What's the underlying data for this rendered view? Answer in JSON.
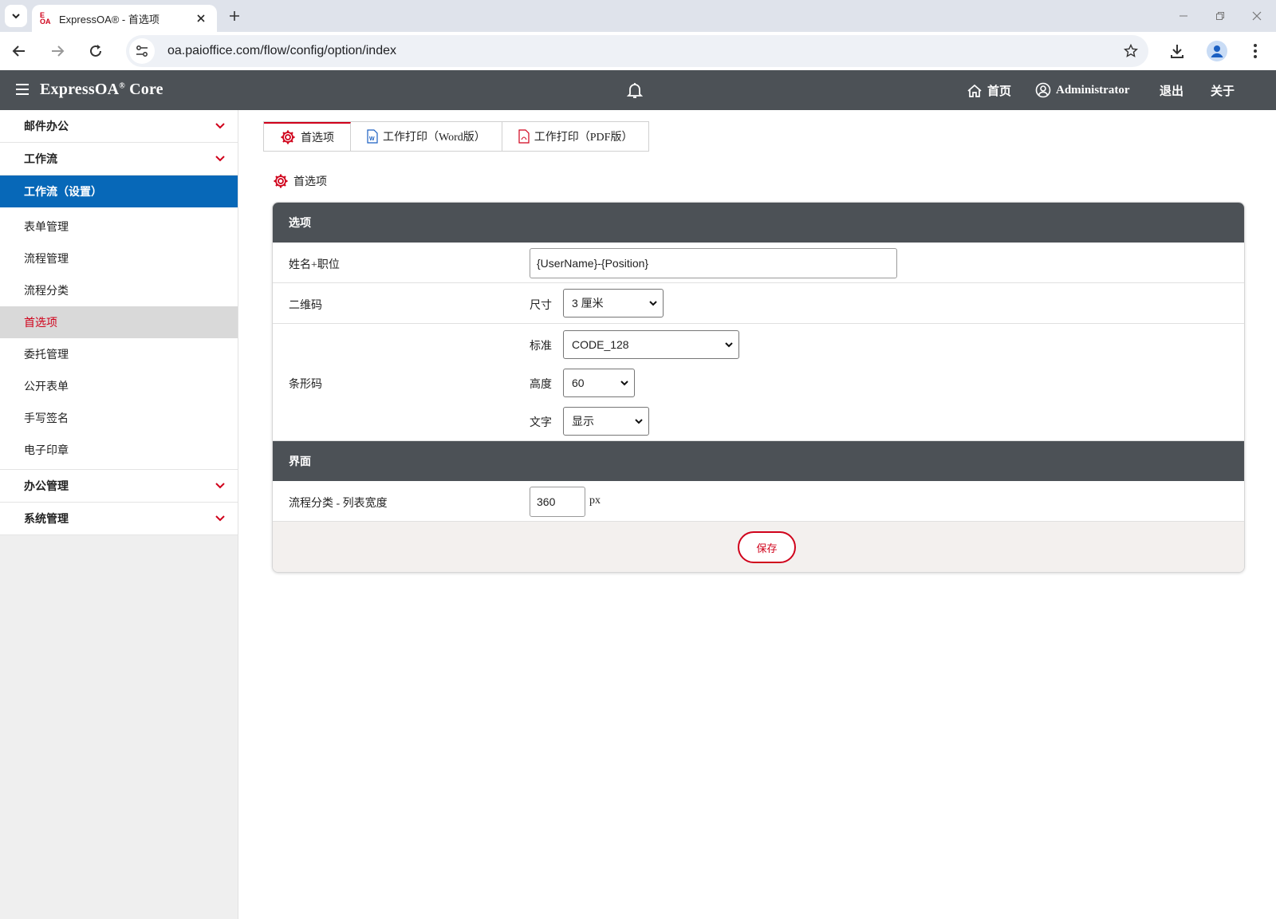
{
  "browser": {
    "tab_title": "ExpressOA® - 首选项",
    "favicon_text_top": "E",
    "favicon_text_bottom": "OA",
    "url": "oa.paioffice.com/flow/config/option/index"
  },
  "header": {
    "brand": "ExpressOA",
    "brand_mark": "®",
    "brand_suffix": " Core",
    "home_label": "首页",
    "user_label": "Administrator",
    "logout_label": "退出",
    "about_label": "关于"
  },
  "sidebar": {
    "group_mail": "邮件办公",
    "group_workflow": "工作流",
    "active_section": "工作流（设置）",
    "items": [
      "表单管理",
      "流程管理",
      "流程分类",
      "首选项",
      "委托管理",
      "公开表单",
      "手写签名",
      "电子印章"
    ],
    "group_office": "办公管理",
    "group_system": "系统管理"
  },
  "tabs": {
    "preferences": "首选项",
    "print_word": "工作打印（Word版）",
    "print_pdf": "工作打印（PDF版）"
  },
  "section_title": "首选项",
  "options": {
    "heading": "选项",
    "name_position_label": "姓名+职位",
    "name_position_value": "{UserName}-{Position}",
    "qrcode_label": "二维码",
    "qrcode_size_label": "尺寸",
    "qrcode_size_value": "3 厘米",
    "barcode_label": "条形码",
    "barcode_standard_label": "标准",
    "barcode_standard_value": "CODE_128",
    "barcode_height_label": "高度",
    "barcode_height_value": "60",
    "barcode_text_label": "文字",
    "barcode_text_value": "显示"
  },
  "interface": {
    "heading": "界面",
    "list_width_label": "流程分类 - 列表宽度",
    "list_width_value": "360",
    "list_width_unit": "px"
  },
  "save_label": "保存",
  "colors": {
    "header_bg": "#4c5156",
    "active_blue": "#0768b8",
    "accent_red": "#d0021b"
  }
}
